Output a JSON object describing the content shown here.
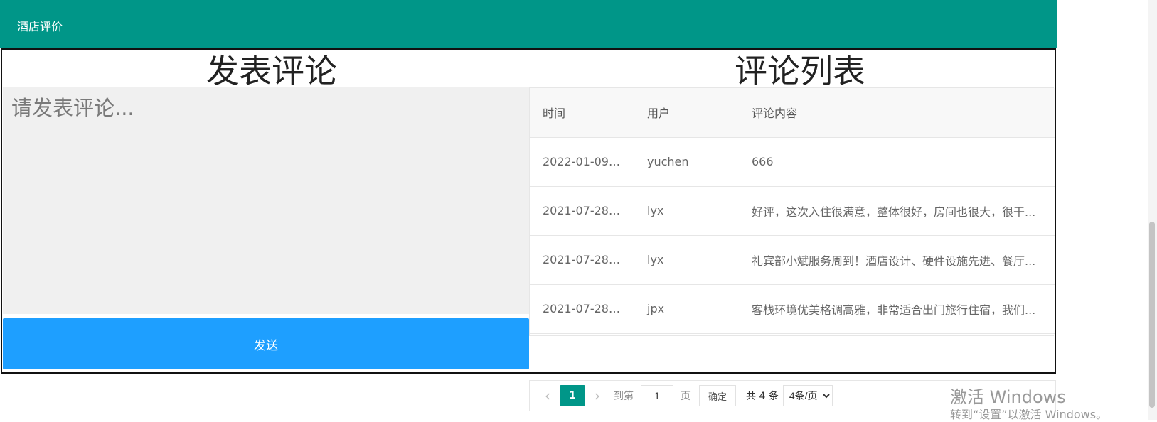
{
  "header": {
    "title": "酒店评价"
  },
  "compose": {
    "title": "发表评论",
    "placeholder": "请发表评论...",
    "send_label": "发送"
  },
  "list": {
    "title": "评论列表",
    "columns": [
      "时间",
      "用户",
      "评论内容"
    ],
    "rows": [
      {
        "time": "2022-01-09T...",
        "user": "yuchen",
        "content": "666"
      },
      {
        "time": "2021-07-28T...",
        "user": "lyx",
        "content": "好评，这次入住很满意，整体很好，房间也很大，很干..."
      },
      {
        "time": "2021-07-28T...",
        "user": "lyx",
        "content": "礼宾部小斌服务周到！酒店设计、硬件设施先进、餐厅..."
      },
      {
        "time": "2021-07-28T...",
        "user": "jpx",
        "content": "客栈环境优美格调高雅，非常适合出门旅行住宿，我们..."
      }
    ]
  },
  "pagination": {
    "current_page": "1",
    "goto_prefix": "到第",
    "goto_value": "1",
    "goto_suffix": "页",
    "confirm_label": "确定",
    "total_text": "共 4 条",
    "page_size": "4条/页"
  },
  "watermark": {
    "line1": "激活 Windows",
    "line2": "转到“设置”以激活 Windows。"
  },
  "colors": {
    "header_bg": "#009688",
    "send_button_bg": "#1e9fff",
    "pager_active_bg": "#009688"
  }
}
